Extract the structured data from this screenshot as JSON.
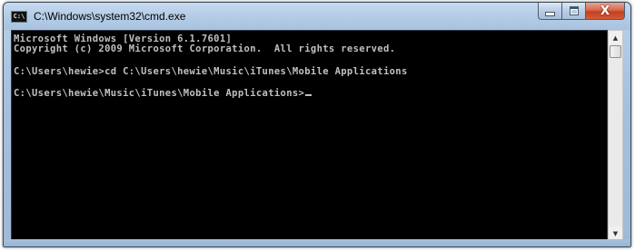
{
  "window": {
    "title": "C:\\Windows\\system32\\cmd.exe",
    "icon_text": "C:\\",
    "icon": "cmd-icon"
  },
  "caption_buttons": {
    "minimize_icon": "minimize-icon",
    "maximize_icon": "maximize-icon",
    "close_icon": "close-icon",
    "close_label": "X"
  },
  "console": {
    "lines": [
      "Microsoft Windows [Version 6.1.7601]",
      "Copyright (c) 2009 Microsoft Corporation.  All rights reserved.",
      "",
      "C:\\Users\\hewie>cd C:\\Users\\hewie\\Music\\iTunes\\Mobile Applications",
      "",
      "C:\\Users\\hewie\\Music\\iTunes\\Mobile Applications>"
    ],
    "background": "#000000",
    "foreground": "#c0c0c0"
  },
  "scrollbar": {
    "up_arrow": "▲",
    "down_arrow": "▼"
  },
  "colors": {
    "titlebar": "#b4cce6",
    "close_button": "#c4401f"
  }
}
